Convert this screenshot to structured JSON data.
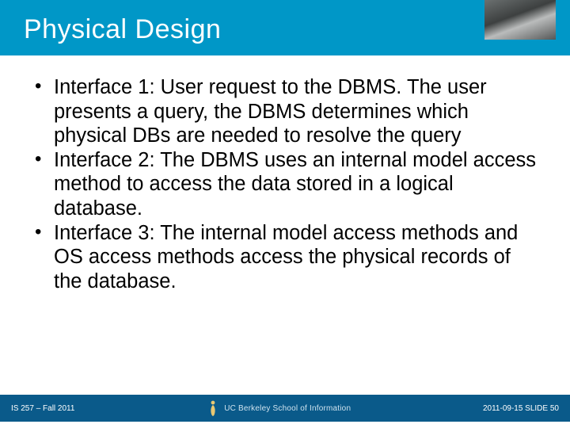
{
  "header": {
    "title": "Physical Design"
  },
  "body": {
    "bullets": [
      "Interface 1: User request to the DBMS. The user presents a query, the DBMS determines which physical DBs are needed to resolve the query",
      "Interface 2: The DBMS uses an internal model access method to access the data stored in a logical database.",
      "Interface 3:  The internal model access methods and  OS access methods access the physical records of the database."
    ]
  },
  "footer": {
    "left": "IS 257 – Fall 2011",
    "logo_text": "UC Berkeley School of Information",
    "right": "2011-09-15 SLIDE 50"
  },
  "colors": {
    "title_band": "#0097c7",
    "footer_band": "#0a5a8a"
  }
}
